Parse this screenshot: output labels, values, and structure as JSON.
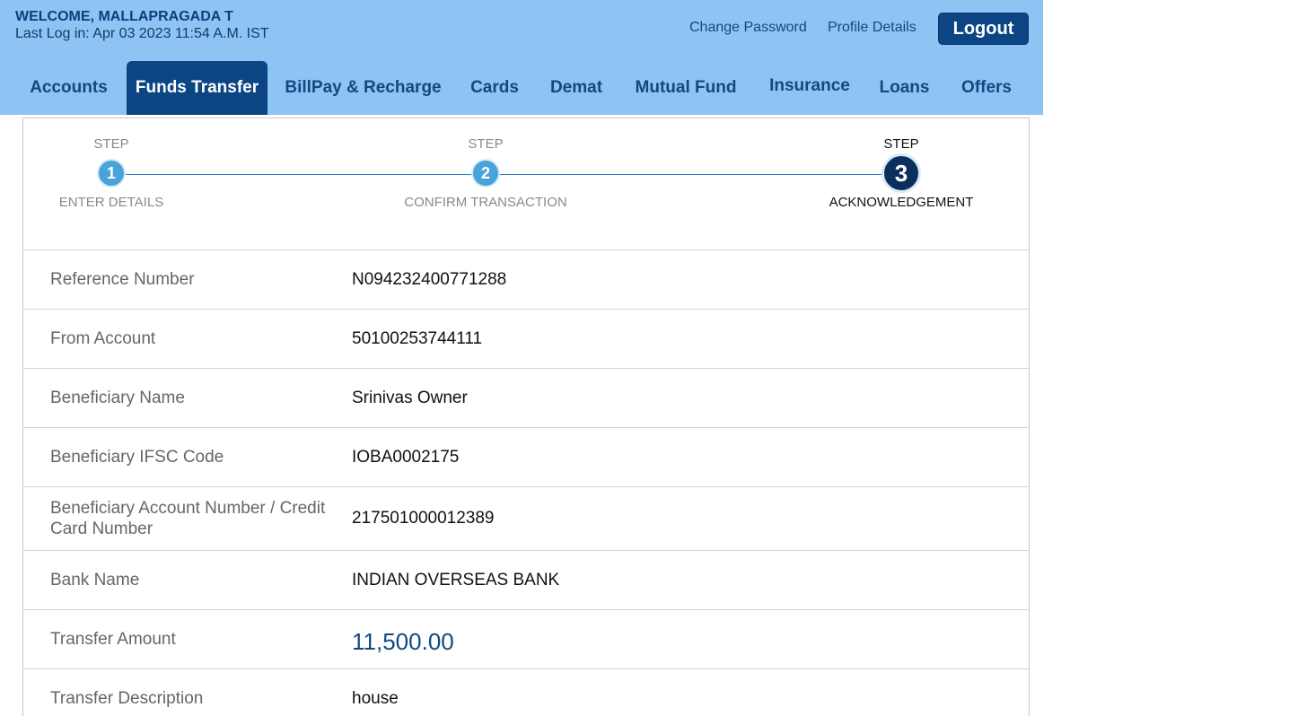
{
  "header": {
    "welcome": "WELCOME, MALLAPRAGADA T",
    "last_login": "Last Log in: Apr 03 2023 11:54 A.M. IST",
    "change_password": "Change Password",
    "profile_details": "Profile Details",
    "logout": "Logout"
  },
  "nav": {
    "tabs": [
      {
        "label": "Accounts"
      },
      {
        "label": "Funds Transfer"
      },
      {
        "label": "BillPay & Recharge"
      },
      {
        "label": "Cards"
      },
      {
        "label": "Demat"
      },
      {
        "label": "Mutual Fund"
      },
      {
        "label": "Insurance"
      },
      {
        "label": "Loans"
      },
      {
        "label": "Offers"
      }
    ],
    "active": "Funds Transfer"
  },
  "steps": [
    {
      "top": "STEP",
      "number": "1",
      "bottom": "ENTER DETAILS"
    },
    {
      "top": "STEP",
      "number": "2",
      "bottom": "CONFIRM TRANSACTION"
    },
    {
      "top": "STEP",
      "number": "3",
      "bottom": "ACKNOWLEDGEMENT"
    }
  ],
  "current_step": "3",
  "details": [
    {
      "label": "Reference Number",
      "value": "N094232400771288"
    },
    {
      "label": "From Account",
      "value": "50100253744111"
    },
    {
      "label": "Beneficiary Name",
      "value": "Srinivas Owner"
    },
    {
      "label": "Beneficiary IFSC Code",
      "value": "IOBA0002175"
    },
    {
      "label": "Beneficiary Account Number / Credit Card Number",
      "value": "217501000012389"
    },
    {
      "label": "Bank Name",
      "value": "INDIAN OVERSEAS BANK"
    },
    {
      "label": "Transfer Amount",
      "value": "11,500.00"
    },
    {
      "label": "Transfer Description",
      "value": "house"
    }
  ],
  "colors": {
    "header_bg": "#8ec4f4",
    "primary": "#0b4584",
    "step_active": "#0b2f5c",
    "step_done": "#4aa3d8"
  }
}
